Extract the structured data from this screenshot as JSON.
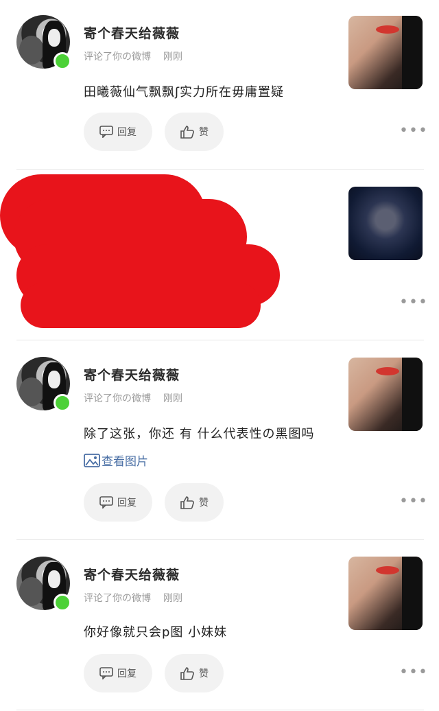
{
  "colors": {
    "redaction": "#e8141b",
    "online": "#4cd137",
    "link": "#4a6fa5"
  },
  "actions": {
    "reply_label": "回复",
    "like_label": "赞",
    "reply_icon": "comment-icon",
    "like_icon": "thumbs-up-icon",
    "more_icon": "more-icon"
  },
  "notifications": [
    {
      "username": "寄个春天给薇薇",
      "action": "评论了你の微博",
      "time": "刚刚",
      "content": "田曦薇仙气飘飘ʃ实力所在毋庸置疑",
      "has_thumbnail": true
    },
    {
      "redacted": true,
      "has_thumbnail": true
    },
    {
      "username": "寄个春天给薇薇",
      "action": "评论了你の微博",
      "time": "刚刚",
      "content": "除了这张，你还 有 什么代表性の黑图吗",
      "view_image_label": "查看图片",
      "has_thumbnail": true
    },
    {
      "username": "寄个春天给薇薇",
      "action": "评论了你の微博",
      "time": "刚刚",
      "content": "你好像就只会p图  小妹妹",
      "has_thumbnail": true
    }
  ],
  "more_glyph": "•••"
}
